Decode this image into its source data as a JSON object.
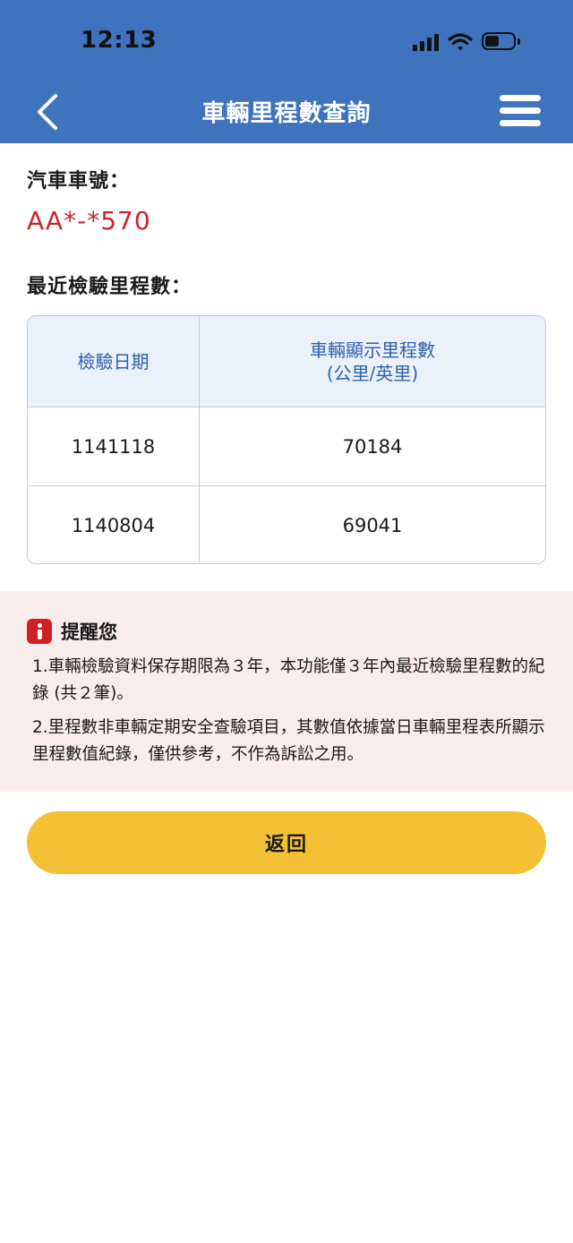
{
  "status_bar": {
    "time": "12:13",
    "battery_level": 0.5
  },
  "header": {
    "title": "車輛里程數查詢",
    "back_icon": "chevron-left-icon",
    "menu_icon": "hamburger-menu-icon"
  },
  "vehicle": {
    "plate_label": "汽車車號：",
    "plate_number": "AA*-*570"
  },
  "inspection": {
    "section_label": "最近檢驗里程數：",
    "columns": [
      "檢驗日期",
      "車輛顯示里程數",
      "(公里/英里)"
    ],
    "rows": [
      {
        "date": "1141118",
        "mileage": "70184"
      },
      {
        "date": "1140804",
        "mileage": "69041"
      }
    ]
  },
  "reminder": {
    "title": "提醒您",
    "items": [
      "1.車輛檢驗資料保存期限為３年，本功能僅３年內最近檢驗里程數的紀錄 (共２筆)。",
      "2.里程數非車輛定期安全查驗項目，其數值依據當日車輛里程表所顯示里程數值紀錄，僅供參考，不作為訴訟之用。"
    ]
  },
  "actions": {
    "back_label": "返回"
  },
  "colors": {
    "header": "#3f73bd",
    "accent_red": "#c7242b",
    "button": "#f3c033",
    "notice_bg": "#f9ecec"
  }
}
